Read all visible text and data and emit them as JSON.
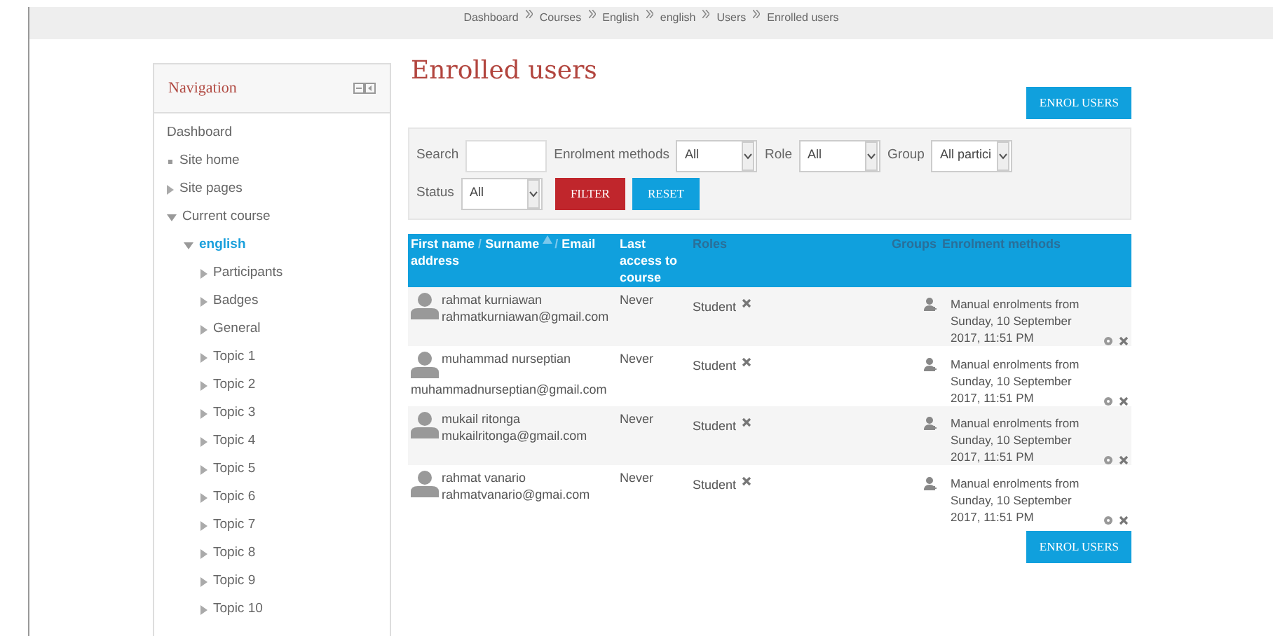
{
  "breadcrumb": [
    "Dashboard",
    "Courses",
    "English",
    "english",
    "Users",
    "Enrolled users"
  ],
  "navigation": {
    "title": "Navigation",
    "items": [
      {
        "label": "Dashboard",
        "kind": "plain"
      },
      {
        "label": "Site home",
        "kind": "leaf"
      },
      {
        "label": "Site pages",
        "kind": "branch",
        "expanded": false
      },
      {
        "label": "Current course",
        "kind": "branch",
        "expanded": true,
        "children": [
          {
            "label": "english",
            "kind": "branch",
            "expanded": true,
            "selected": true,
            "children": [
              {
                "label": "Participants",
                "kind": "branch",
                "expanded": false
              },
              {
                "label": "Badges",
                "kind": "branch",
                "expanded": false
              },
              {
                "label": "General",
                "kind": "branch",
                "expanded": false
              },
              {
                "label": "Topic 1",
                "kind": "branch",
                "expanded": false
              },
              {
                "label": "Topic 2",
                "kind": "branch",
                "expanded": false
              },
              {
                "label": "Topic 3",
                "kind": "branch",
                "expanded": false
              },
              {
                "label": "Topic 4",
                "kind": "branch",
                "expanded": false
              },
              {
                "label": "Topic 5",
                "kind": "branch",
                "expanded": false
              },
              {
                "label": "Topic 6",
                "kind": "branch",
                "expanded": false
              },
              {
                "label": "Topic 7",
                "kind": "branch",
                "expanded": false
              },
              {
                "label": "Topic 8",
                "kind": "branch",
                "expanded": false
              },
              {
                "label": "Topic 9",
                "kind": "branch",
                "expanded": false
              },
              {
                "label": "Topic 10",
                "kind": "branch",
                "expanded": false
              }
            ]
          }
        ]
      }
    ]
  },
  "title": "Enrolled users",
  "enrol_button_top": "ENROL USERS",
  "filter": {
    "search_label": "Search",
    "selects": [
      {
        "label": "Enrolment methods",
        "value": "All"
      },
      {
        "label": "Role",
        "value": "All"
      },
      {
        "label": "Group",
        "value": "All partici"
      }
    ],
    "status_label": "Status",
    "status_value": "All",
    "filter_button": "FILTER",
    "reset_button": "RESET"
  },
  "table": {
    "name_header": {
      "first": "First name",
      "sep1": "/",
      "second": "Surname",
      "sep2": "/",
      "third": "Email address"
    },
    "columns": [
      {
        "label": "Last access to course",
        "sortable": true
      },
      {
        "label": "Roles",
        "sortable": false
      },
      {
        "label": "Groups",
        "sortable": false
      },
      {
        "label": "Enrolment methods",
        "sortable": false
      }
    ],
    "rows": [
      {
        "name": "rahmat kurniawan",
        "email": "rahmatkurniawan@gmail.com",
        "last_access": "Never",
        "role": "Student",
        "enrolment": "Manual enrolments from Sunday, 10 September 2017, 11:51 PM"
      },
      {
        "name": "muhammad nurseptian",
        "email": "muhammadnurseptian@gmail.com",
        "last_access": "Never",
        "role": "Student",
        "enrolment": "Manual enrolments from Sunday, 10 September 2017, 11:51 PM"
      },
      {
        "name": "mukail ritonga",
        "email": "mukailritonga@gmail.com",
        "last_access": "Never",
        "role": "Student",
        "enrolment": "Manual enrolments from Sunday, 10 September 2017, 11:51 PM"
      },
      {
        "name": "rahmat vanario",
        "email": "rahmatvanario@gmai.com",
        "last_access": "Never",
        "role": "Student",
        "enrolment": "Manual enrolments from Sunday, 10 September 2017, 11:51 PM"
      }
    ]
  },
  "enrol_button_bottom": "ENROL USERS"
}
